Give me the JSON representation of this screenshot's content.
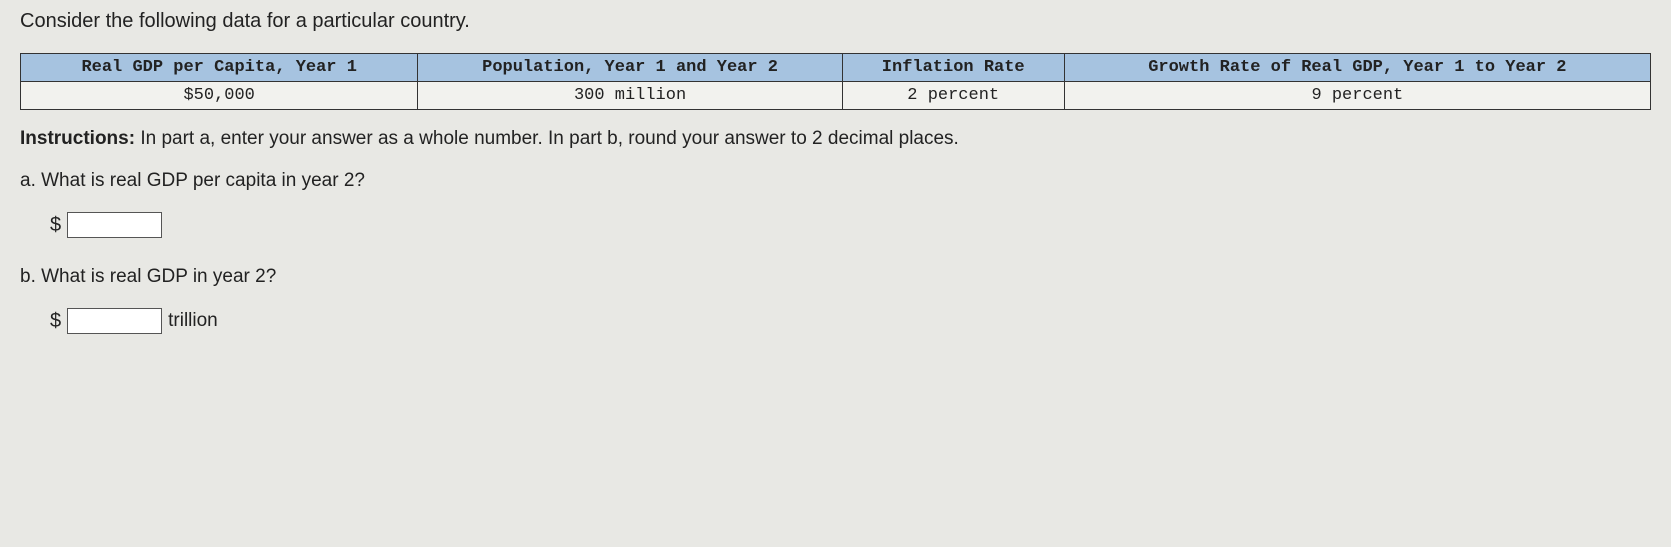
{
  "intro": "Consider the following data for a particular country.",
  "table": {
    "headers": [
      "Real GDP per Capita, Year 1",
      "Population, Year 1 and Year 2",
      "Inflation Rate",
      "Growth Rate of Real GDP, Year 1 to Year 2"
    ],
    "values": [
      "$50,000",
      "300 million",
      "2 percent",
      "9 percent"
    ]
  },
  "instructions_label": "Instructions:",
  "instructions_text": " In part a, enter your answer as a whole number. In part b, round your answer to 2 decimal places.",
  "qa_label": "a. What is real GDP per capita in year 2?",
  "qb_label": "b. What is real GDP in year 2?",
  "dollar": "$",
  "unit_b": "trillion"
}
